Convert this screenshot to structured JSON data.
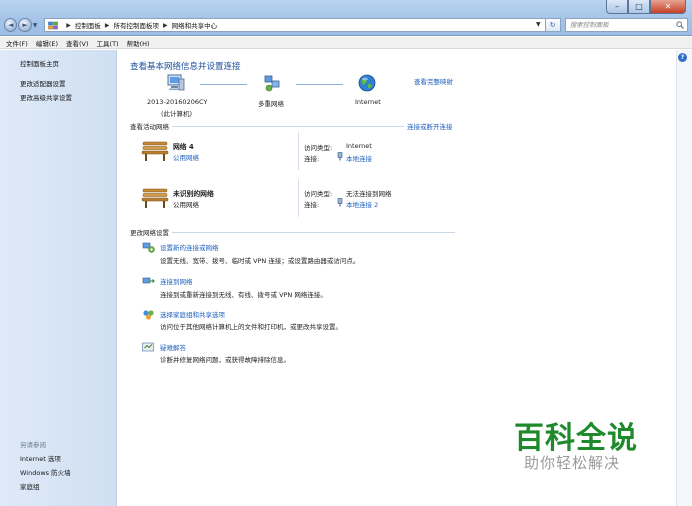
{
  "window": {
    "minimize_glyph": "–",
    "maximize_glyph": "□",
    "close_glyph": "✕"
  },
  "navigation": {
    "back_glyph": "◄",
    "forward_glyph": "►",
    "dropdown_glyph": "▼",
    "refresh_glyph": "↻",
    "breadcrumb": [
      "控制面板",
      "所有控制面板项",
      "网络和共享中心"
    ],
    "search_placeholder": "搜索控制面板"
  },
  "menubar": {
    "items": [
      "文件(F)",
      "编辑(E)",
      "查看(V)",
      "工具(T)",
      "帮助(H)"
    ]
  },
  "sidebar": {
    "links": [
      "控制面板主页",
      "更改适配器设置",
      "更改高级共享设置"
    ],
    "see_also_heading": "另请参阅",
    "see_also": [
      "Internet 选项",
      "Windows 防火墙",
      "家庭组"
    ]
  },
  "main": {
    "title": "查看基本网络信息并设置连接",
    "view_full_map": "查看完整映射",
    "map": {
      "computer_name": "2013-20160206CY",
      "computer_sub": "(此计算机)",
      "multi_network": "多重网络",
      "internet": "Internet"
    },
    "active_networks_heading": "查看活动网络",
    "connect_disconnect": "连接或断开连接",
    "networks": [
      {
        "name": "网络  4",
        "type": "公用网络",
        "access_label": "访问类型:",
        "access_value": "Internet",
        "conn_label": "连接:",
        "conn_value": "本地连接"
      },
      {
        "name": "未识别的网络",
        "type": "公用网络",
        "access_label": "访问类型:",
        "access_value": "无法连接到网络",
        "conn_label": "连接:",
        "conn_value": "本地连接 2"
      }
    ],
    "change_settings_heading": "更改网络设置",
    "tasks": [
      {
        "link": "设置新的连接或网络",
        "desc": "设置无线、宽带、拨号、临时或 VPN 连接；或设置路由器或访问点。"
      },
      {
        "link": "连接到网络",
        "desc": "连接到或重新连接到无线、有线、拨号或 VPN 网络连接。"
      },
      {
        "link": "选择家庭组和共享选项",
        "desc": "访问位于其他网络计算机上的文件和打印机，或更改共享设置。"
      },
      {
        "link": "疑难解答",
        "desc": "诊断并修复网络问题，或获得故障排除信息。"
      }
    ],
    "help_glyph": "?"
  },
  "watermark": {
    "brand": "百科全说",
    "tagline": "助你轻松解决"
  },
  "colors": {
    "link": "#1c5fbe",
    "title": "#1d4fa0",
    "watermark_green": "#1f8a2c",
    "sidebar_bg": "#d6e4f5"
  }
}
